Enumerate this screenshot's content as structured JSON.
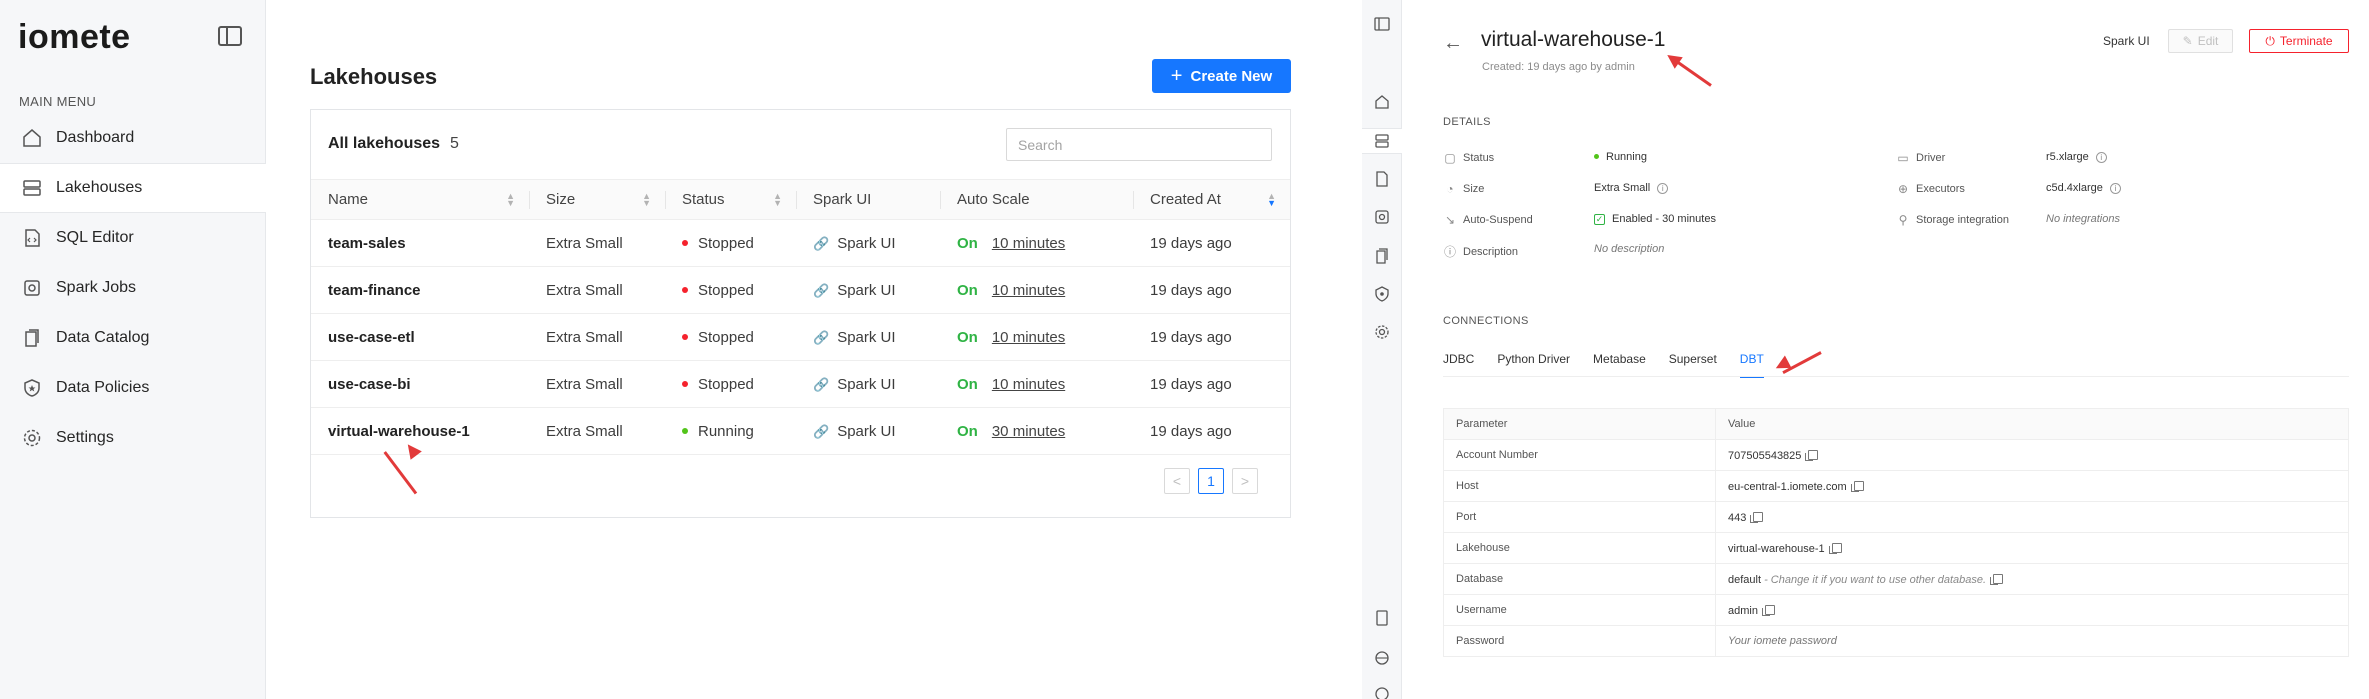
{
  "sidebar": {
    "logo": "iomete",
    "menu_title": "MAIN MENU",
    "items": [
      {
        "label": "Dashboard",
        "icon": "home-icon"
      },
      {
        "label": "Lakehouses",
        "icon": "server-icon"
      },
      {
        "label": "SQL Editor",
        "icon": "code-file-icon"
      },
      {
        "label": "Spark Jobs",
        "icon": "cog-square-icon"
      },
      {
        "label": "Data Catalog",
        "icon": "catalog-icon"
      },
      {
        "label": "Data Policies",
        "icon": "shield-icon"
      },
      {
        "label": "Settings",
        "icon": "gear-icon"
      }
    ]
  },
  "main": {
    "title": "Lakehouses",
    "create_label": "Create New",
    "card_title": "All lakehouses",
    "count": "5",
    "search_placeholder": "Search",
    "columns": [
      "Name",
      "Size",
      "Status",
      "Spark UI",
      "Auto Scale",
      "Created At"
    ],
    "rows": [
      {
        "name": "team-sales",
        "size": "Extra Small",
        "status": "Stopped",
        "spark": "Spark UI",
        "on": "On",
        "scale": "10 minutes",
        "created": "19 days ago"
      },
      {
        "name": "team-finance",
        "size": "Extra Small",
        "status": "Stopped",
        "spark": "Spark UI",
        "on": "On",
        "scale": "10 minutes",
        "created": "19 days ago"
      },
      {
        "name": "use-case-etl",
        "size": "Extra Small",
        "status": "Stopped",
        "spark": "Spark UI",
        "on": "On",
        "scale": "10 minutes",
        "created": "19 days ago"
      },
      {
        "name": "use-case-bi",
        "size": "Extra Small",
        "status": "Stopped",
        "spark": "Spark UI",
        "on": "On",
        "scale": "10 minutes",
        "created": "19 days ago"
      },
      {
        "name": "virtual-warehouse-1",
        "size": "Extra Small",
        "status": "Running",
        "spark": "Spark UI",
        "on": "On",
        "scale": "30 minutes",
        "created": "19 days ago"
      }
    ],
    "pager": {
      "prev": "<",
      "current": "1",
      "next": ">"
    }
  },
  "detail": {
    "title": "virtual-warehouse-1",
    "subtitle": "Created: 19 days ago by admin",
    "spark_ui": "Spark UI",
    "edit": "Edit",
    "terminate": "Terminate",
    "details_title": "DETAILS",
    "left": [
      {
        "key": "Status",
        "value": "Running"
      },
      {
        "key": "Size",
        "value": "Extra Small"
      },
      {
        "key": "Auto-Suspend",
        "value": "Enabled - 30 minutes"
      },
      {
        "key": "Description",
        "value": "No description"
      }
    ],
    "right": [
      {
        "key": "Driver",
        "value": "r5.xlarge"
      },
      {
        "key": "Executors",
        "value": "c5d.4xlarge"
      },
      {
        "key": "Storage integration",
        "value": "No integrations"
      }
    ],
    "connections_title": "CONNECTIONS",
    "tabs": [
      "JDBC",
      "Python Driver",
      "Metabase",
      "Superset",
      "DBT"
    ],
    "params_header": [
      "Parameter",
      "Value"
    ],
    "params": [
      {
        "k": "Account Number",
        "v": "707505543825"
      },
      {
        "k": "Host",
        "v": "eu-central-1.iomete.com"
      },
      {
        "k": "Port",
        "v": "443"
      },
      {
        "k": "Lakehouse",
        "v": "virtual-warehouse-1"
      },
      {
        "k": "Database",
        "v": "default",
        "hint": " - Change it if you want to use other database."
      },
      {
        "k": "Username",
        "v": "admin"
      },
      {
        "k": "Password",
        "v": "Your iomete password"
      }
    ]
  },
  "colors": {
    "accent": "#1677ff",
    "running": "#52c41a",
    "stopped": "#f5222d",
    "annotation": "#e23a3a"
  }
}
